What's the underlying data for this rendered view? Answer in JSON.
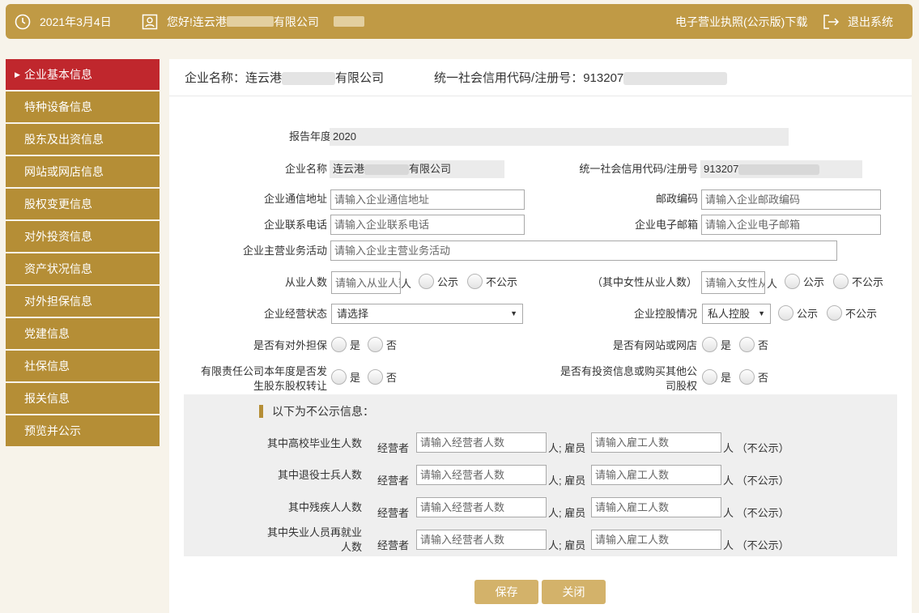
{
  "header": {
    "date": "2021年3月4日",
    "greeting_prefix": "您好!连云港",
    "greeting_suffix": "有限公司",
    "license_download": "电子营业执照(公示版)下载",
    "logout": "退出系统"
  },
  "sidebar": {
    "items": [
      {
        "label": "企业基本信息"
      },
      {
        "label": "特种设备信息"
      },
      {
        "label": "股东及出资信息"
      },
      {
        "label": "网站或网店信息"
      },
      {
        "label": "股权变更信息"
      },
      {
        "label": "对外投资信息"
      },
      {
        "label": "资产状况信息"
      },
      {
        "label": "对外担保信息"
      },
      {
        "label": "党建信息"
      },
      {
        "label": "社保信息"
      },
      {
        "label": "报关信息"
      },
      {
        "label": "预览并公示"
      }
    ]
  },
  "main_header": {
    "name_label": "企业名称：连云港",
    "name_suffix": "有限公司",
    "code_label": "统一社会信用代码/注册号：913207"
  },
  "form": {
    "report_year_label": "报告年度",
    "report_year": "2020",
    "company_name_label": "企业名称",
    "company_name_prefix": "连云港",
    "company_name_suffix": "有限公司",
    "credit_code_label": "统一社会信用代码/注册号",
    "credit_code_prefix": "913207",
    "address_label": "企业通信地址",
    "address_placeholder": "请输入企业通信地址",
    "postcode_label": "邮政编码",
    "postcode_placeholder": "请输入企业邮政编码",
    "phone_label": "企业联系电话",
    "phone_placeholder": "请输入企业联系电话",
    "email_label": "企业电子邮箱",
    "email_placeholder": "请输入企业电子邮箱",
    "business_label": "企业主营业务活动",
    "business_placeholder": "请输入企业主营业务活动",
    "employees_label": "从业人数",
    "employees_placeholder": "请输入从业人数",
    "female_label": "（其中女性从业人数）",
    "female_placeholder": "请输入女性从业人数",
    "unit_person": "人",
    "public_label": "公示",
    "nonpublic_label": "不公示",
    "status_label": "企业经营状态",
    "status_value": "请选择",
    "control_label": "企业控股情况",
    "control_value": "私人控股",
    "guarantee_label": "是否有对外担保",
    "website_label": "是否有网站或网店",
    "equity_transfer_label_1": "有限责任公司本年度是否发",
    "equity_transfer_label_2": "生股东股权转让",
    "investment_label_1": "是否有投资信息或购买其他公",
    "investment_label_2": "司股权",
    "yes_label": "是",
    "no_label": "否"
  },
  "nonpublic_section": {
    "title": "以下为不公示信息：",
    "operator_label": "经营者",
    "operator_placeholder": "请输入经营者人数",
    "employee_sep": "人; 雇员",
    "employee_placeholder": "请输入雇工人数",
    "tail": "人 （不公示）",
    "rows": [
      {
        "label_1": "其中高校毕业生人数",
        "label_2": ""
      },
      {
        "label_1": "其中退役士兵人数",
        "label_2": ""
      },
      {
        "label_1": "其中残疾人人数",
        "label_2": ""
      },
      {
        "label_1": "其中失业人员再就业",
        "label_2": "人数"
      }
    ]
  },
  "buttons": {
    "save": "保存",
    "close": "关闭"
  }
}
